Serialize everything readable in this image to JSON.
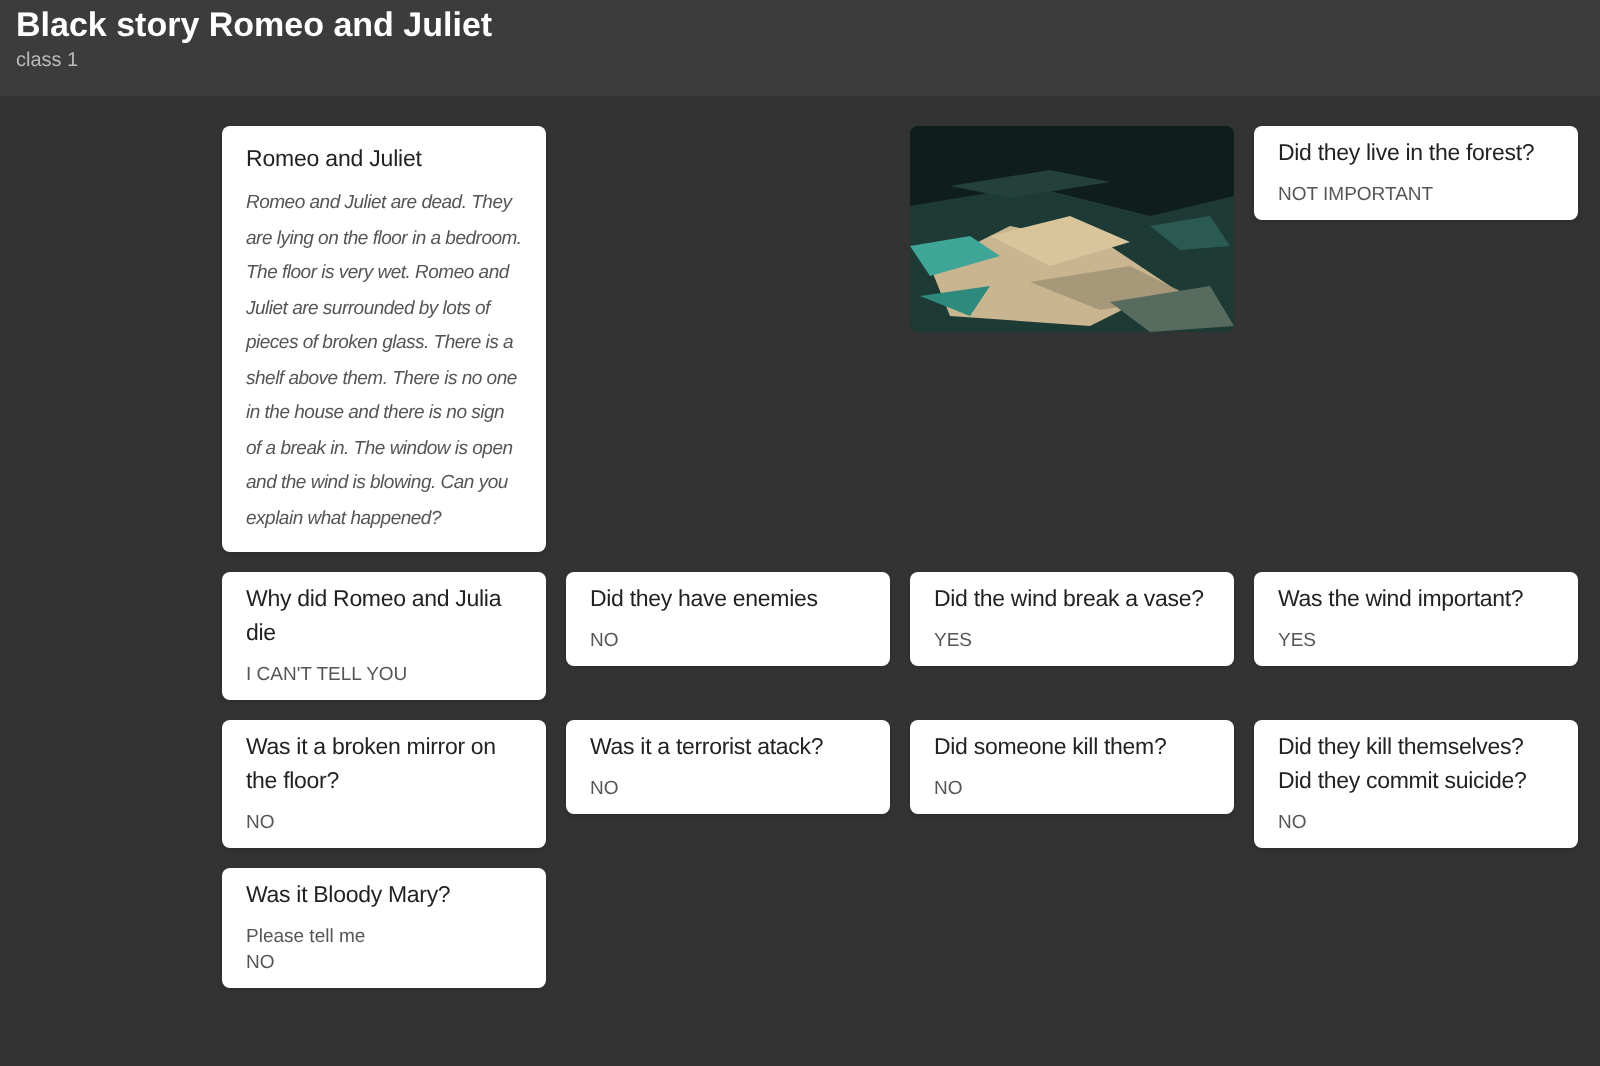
{
  "header": {
    "title": "Black story Romeo and Juliet",
    "subtitle": "class 1"
  },
  "rows": [
    [
      {
        "kind": "story",
        "title": "Romeo and Juliet",
        "text": "Romeo and Juliet are dead. They are lying on the floor in a bedroom. The floor is very wet. Romeo and Juliet are surrounded by lots of pieces of broken glass. There is a shelf above them. There is no one in the house and there is no sign of a break in. The window is open and the wind is blowing. Can you explain what happened?"
      },
      {
        "kind": "empty"
      },
      {
        "kind": "picture"
      },
      {
        "kind": "question",
        "title": "Did they live in the forest?",
        "body": [
          "NOT IMPORTANT"
        ]
      }
    ],
    [
      {
        "kind": "question",
        "title": "Why did Romeo and Julia die",
        "body": [
          "I CAN'T TELL YOU"
        ]
      },
      {
        "kind": "question",
        "title": "Did they have enemies",
        "body": [
          "NO"
        ]
      },
      {
        "kind": "question",
        "title": "Did the wind break a vase?",
        "body": [
          "YES"
        ]
      },
      {
        "kind": "question",
        "title": "Was the wind important?",
        "body": [
          "YES"
        ]
      }
    ],
    [
      {
        "kind": "question",
        "title": "Was it a broken mirror on the floor?",
        "body": [
          "NO"
        ]
      },
      {
        "kind": "question",
        "title": "Was it a terrorist atack?",
        "body": [
          "NO"
        ]
      },
      {
        "kind": "question",
        "title": "Did someone kill them?",
        "body": [
          "NO"
        ]
      },
      {
        "kind": "question",
        "title": "Did they kill themselves? Did they commit suicide?",
        "body": [
          "NO"
        ]
      }
    ],
    [
      {
        "kind": "question",
        "title": "Was it Bloody  Mary?",
        "body": [
          "Please tell me",
          "NO"
        ]
      }
    ]
  ]
}
